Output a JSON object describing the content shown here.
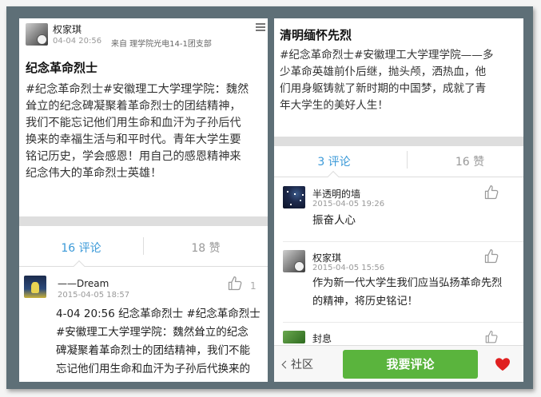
{
  "left": {
    "post": {
      "author": "权家琪",
      "time": "04-04 20:56",
      "source": "来自 理学院光电14-1团支部",
      "title": "纪念革命烈士",
      "body_lines": [
        "#纪念革命烈士#安徽理工大学理学院：魏然",
        "耸立的纪念碑凝聚着革命烈士的团结精神，",
        "我们不能忘记他们用生命和血汗为子孙后代",
        "换来的幸福生活与和平时代。青年大学生要",
        "铭记历史，学会感恩！用自己的感恩精神来",
        "纪念伟大的革命烈士英雄！"
      ]
    },
    "tabs": {
      "comments": "16 评论",
      "likes": "18 赞"
    },
    "comment": {
      "name": "——Dream",
      "time": "2015-04-05 18:57",
      "likes": "1",
      "text_lines": [
        "4-04 20:56 纪念革命烈士 #纪念革命烈士",
        "#安徽理工大学理学院：魏然耸立的纪念",
        "碑凝聚着革命烈士的团结精神，我们不能",
        "忘记他们用生命和血汗为子孙后代换来的"
      ]
    }
  },
  "right": {
    "title": "清明缅怀先烈",
    "body_lines": [
      "#纪念革命烈士#安徽理工大学理学院——多",
      "少革命英雄前仆后继，抛头颅，洒热血，他",
      "们用身躯铸就了新时期的中国梦，成就了青",
      "年大学生的美好人生！"
    ],
    "tabs": {
      "comments": "3 评论",
      "likes": "16 赞"
    },
    "comments": [
      {
        "name": "半透明的墙",
        "time": "2015-04-05 19:26",
        "text_lines": [
          "振奋人心"
        ]
      },
      {
        "name": "权家琪",
        "time": "2015-04-05 15:56",
        "text_lines": [
          "作为新一代大学生我们应当弘扬革命先烈",
          "的精神，将历史铭记！"
        ]
      },
      {
        "name": "封息",
        "time": "",
        "text_lines": []
      }
    ],
    "bottom": {
      "back_label": "社区",
      "comment_button": "我要评论"
    }
  },
  "colors": {
    "accent": "#3a99d8",
    "button": "#5ab43d",
    "heart": "#e02020",
    "frame": "#5e6f77"
  },
  "icons": [
    "thumbs-up-icon",
    "menu-icon",
    "heart-icon",
    "chevron-left-icon"
  ]
}
